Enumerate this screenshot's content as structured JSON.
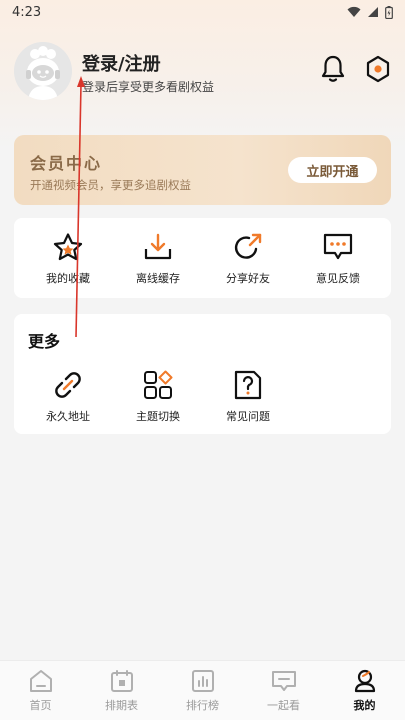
{
  "status_bar": {
    "time": "4:23"
  },
  "profile": {
    "login_title": "登录/注册",
    "login_subtitle": "登录后享受更多看剧权益"
  },
  "vip": {
    "title": "会员中心",
    "subtitle": "开通视频会员，享更多追剧权益",
    "button_label": "立即开通"
  },
  "actions": [
    {
      "label": "我的收藏",
      "icon": "star-icon"
    },
    {
      "label": "离线缓存",
      "icon": "download-icon"
    },
    {
      "label": "分享好友",
      "icon": "share-icon"
    },
    {
      "label": "意见反馈",
      "icon": "feedback-icon"
    }
  ],
  "more": {
    "title": "更多",
    "items": [
      {
        "label": "永久地址",
        "icon": "link-icon"
      },
      {
        "label": "主题切换",
        "icon": "theme-icon"
      },
      {
        "label": "常见问题",
        "icon": "question-icon"
      }
    ]
  },
  "tabs": [
    {
      "label": "首页",
      "icon": "home-icon",
      "active": false
    },
    {
      "label": "排期表",
      "icon": "calendar-icon",
      "active": false
    },
    {
      "label": "排行榜",
      "icon": "ranking-icon",
      "active": false
    },
    {
      "label": "一起看",
      "icon": "watch-together-icon",
      "active": false
    },
    {
      "label": "我的",
      "icon": "profile-icon",
      "active": true
    }
  ],
  "colors": {
    "accent_orange": "#f07a2a",
    "vip_gold": "#8a6a48",
    "annotation_red": "#d9362b"
  }
}
